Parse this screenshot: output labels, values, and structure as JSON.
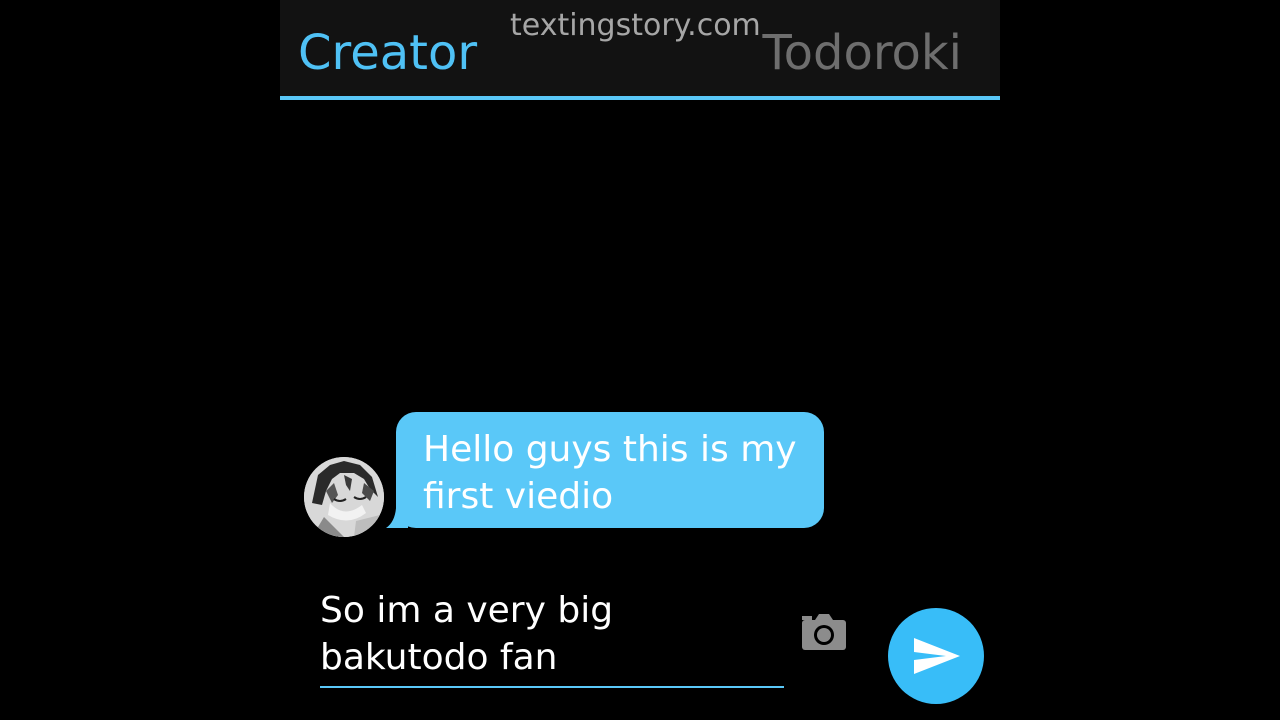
{
  "watermark": "textingstory.com",
  "header": {
    "creator_label": "Creator",
    "contact_name": "Todoroki"
  },
  "messages": [
    {
      "sender": "Todoroki",
      "text": "Hello guys this is my first viedio",
      "bubble_color": "#5ac8f8"
    }
  ],
  "composer": {
    "value": "So im a very big bakutodo fan",
    "send_icon": "send-icon",
    "camera_icon": "camera-icon"
  },
  "colors": {
    "accent": "#5ac8f8",
    "header_bg": "#121212",
    "background": "#000000",
    "inactive_tab": "#6e6e6e"
  }
}
